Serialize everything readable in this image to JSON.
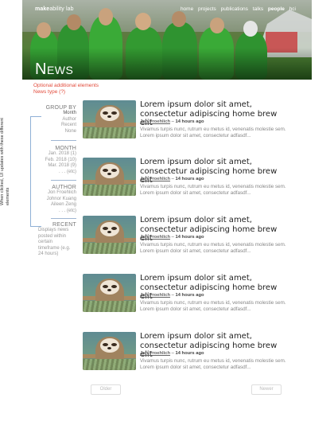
{
  "header": {
    "logo": {
      "bold": "make",
      "rest": "ability lab"
    },
    "nav": [
      "home",
      "projects",
      "publications",
      "talks",
      "people",
      "hci"
    ],
    "active_nav": "people",
    "title": "News"
  },
  "notes": {
    "optional": "Optional additional elements",
    "news_type": "News type (?)"
  },
  "filters": {
    "vertical_label": "When clicked, UI updates with these different elements",
    "group_by": {
      "heading": "GROUP BY",
      "items": [
        "Month",
        "Author",
        "Recent",
        "None"
      ]
    },
    "month": {
      "heading": "MONTH",
      "items": [
        "Jan. 2018 (1)",
        "Feb. 2018 (10)",
        "Mar. 2018 (9)",
        ". . . (etc)"
      ]
    },
    "author": {
      "heading": "AUTHOR",
      "items": [
        "Jon Froehlich",
        "Johnor Kuang",
        "Aileen Zeng",
        ". . . (etc)"
      ]
    },
    "recent": {
      "heading": "RECENT",
      "items": [
        "Displays news",
        "posted within",
        "certain",
        "timeframe (e.g.",
        "24 hours)"
      ]
    }
  },
  "articles": [
    {
      "title": "Lorem ipsum dolor sit amet, consectetur adipiscing home brew elit",
      "author": "Jon Froehlich",
      "time": "14 hours ago",
      "body": "Vivamus turpis nunc, rutrum eu metus id, venenatis molestie sem. Lorem ipsum dolor sit amet, consectetur adfasdf..."
    },
    {
      "title": "Lorem ipsum dolor sit amet, consectetur adipiscing home brew elit",
      "author": "Jon Froehlich",
      "time": "14 hours ago",
      "body": "Vivamus turpis nunc, rutrum eu metus id, venenatis molestie sem. Lorem ipsum dolor sit amet, consectetur adfasdf..."
    },
    {
      "title": "Lorem ipsum dolor sit amet, consectetur adipiscing home brew elit",
      "author": "Jon Froehlich",
      "time": "14 hours ago",
      "body": "Vivamus turpis nunc, rutrum eu metus id, venenatis molestie sem. Lorem ipsum dolor sit amet, consectetur adfasdf..."
    },
    {
      "title": "Lorem ipsum dolor sit amet, consectetur adipiscing home brew elit",
      "author": "Jon Froehlich",
      "time": "14 hours ago",
      "body": "Vivamus turpis nunc, rutrum eu metus id, venenatis molestie sem. Lorem ipsum dolor sit amet, consectetur adfasdf..."
    },
    {
      "title": "Lorem ipsum dolor sit amet, consectetur adipiscing home brew elit",
      "author": "Jon Froehlich",
      "time": "14 hours ago",
      "body": "Vivamus turpis nunc, rutrum eu metus id, venenatis molestie sem. Lorem ipsum dolor sit amet, consectetur adfasdf..."
    }
  ],
  "pager": {
    "older": "Older",
    "newer": "Newer"
  },
  "colors": {
    "note_red": "#e24b3b",
    "bracket_blue": "#8fb0d6",
    "hero_green": "#3f8a2c"
  }
}
